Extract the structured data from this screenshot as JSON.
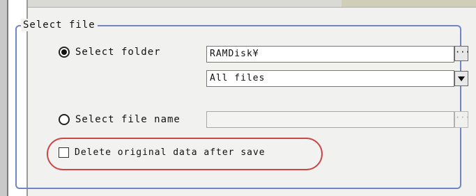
{
  "group": {
    "title": "Select file"
  },
  "options": {
    "select_folder": {
      "label": "Select folder",
      "selected": true,
      "folder_value": "RAMDisk¥",
      "folder_browse_label": "···",
      "file_type_value": "All files"
    },
    "select_file_name": {
      "label": "Select file name",
      "selected": false,
      "value": "",
      "browse_label": "···"
    }
  },
  "delete_original": {
    "label": "Delete original data after save",
    "checked": false
  },
  "colors": {
    "frame": "#6f85c7",
    "highlight": "#c94848"
  }
}
